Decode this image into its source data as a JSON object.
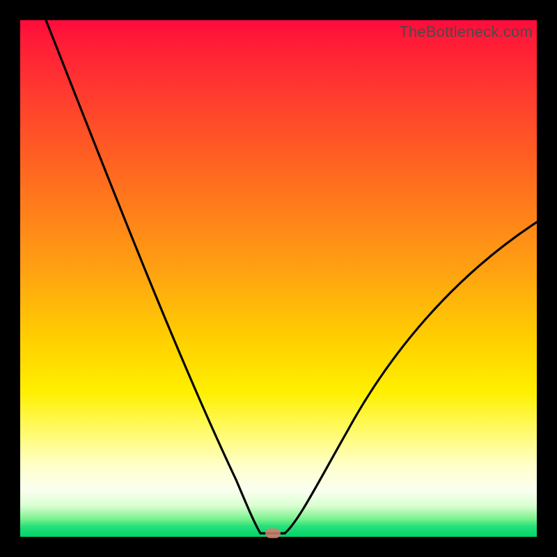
{
  "watermark": "TheBottleneck.com",
  "colors": {
    "frame": "#000000",
    "curve": "#000000",
    "marker": "#d77a6e",
    "gradient_top": "#ff0a3d",
    "gradient_bottom": "#00d46a"
  },
  "chart_data": {
    "type": "line",
    "title": "",
    "xlabel": "",
    "ylabel": "",
    "xlim": [
      0,
      100
    ],
    "ylim": [
      0,
      100
    ],
    "annotations": [
      {
        "text": "TheBottleneck.com",
        "position": "top-right"
      }
    ],
    "marker": {
      "x": 49,
      "y": 0,
      "shape": "rounded-rect",
      "color": "#d77a6e"
    },
    "series": [
      {
        "name": "bottleneck-curve",
        "color": "#000000",
        "x": [
          5,
          10,
          15,
          20,
          25,
          30,
          35,
          40,
          44,
          46,
          48,
          50,
          52,
          55,
          60,
          65,
          70,
          75,
          80,
          85,
          90,
          95,
          100
        ],
        "y": [
          100,
          88,
          76,
          64,
          52,
          41,
          30,
          19,
          9,
          3,
          0.5,
          0.5,
          0.5,
          4,
          12,
          20,
          28,
          35,
          41,
          47,
          52,
          57,
          61
        ]
      }
    ]
  }
}
